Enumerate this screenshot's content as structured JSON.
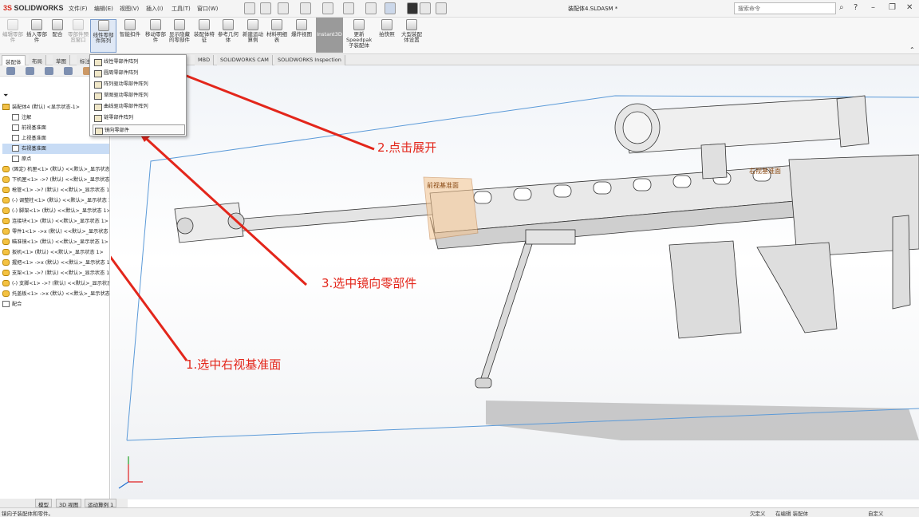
{
  "app": {
    "logo_prefix": "3S",
    "logo_text": "SOLIDWORKS",
    "doc_title": "装配体4.SLDASM *"
  },
  "menu": [
    "文件(F)",
    "编辑(E)",
    "视图(V)",
    "插入(I)",
    "工具(T)",
    "窗口(W)"
  ],
  "search": {
    "placeholder": "搜索命令"
  },
  "ribbon": [
    {
      "label": "编辑零部件",
      "disabled": true
    },
    {
      "label": "插入零部件"
    },
    {
      "label": "配合"
    },
    {
      "label": "零部件预览窗口",
      "disabled": true
    },
    {
      "label": "线性零部件阵列"
    },
    {
      "label": "智能扣件"
    },
    {
      "label": "移动零部件"
    },
    {
      "label": "显示隐藏的零部件"
    },
    {
      "label": "装配体特征"
    },
    {
      "label": "参考几何体"
    },
    {
      "label": "新建运动算例"
    },
    {
      "label": "材料明细表"
    },
    {
      "label": "爆炸视图"
    },
    {
      "label": "Instant3D"
    },
    {
      "label": "更新Speedpak子装配体"
    },
    {
      "label": "拍快照"
    },
    {
      "label": "大型装配体设置"
    }
  ],
  "tabs": [
    "装配体",
    "布局",
    "草图",
    "标注",
    "评估",
    "MBD",
    "SOLIDWORKS CAM",
    "SOLIDWORKS Inspection"
  ],
  "dropdown": [
    "线性零部件阵列",
    "圆周零部件阵列",
    "阵列驱动零部件阵列",
    "草图驱动零部件阵列",
    "曲线驱动零部件阵列",
    "链零部件阵列",
    "镜向零部件"
  ],
  "tree": [
    {
      "label": "装配体4 (默认) <显示状态-1>",
      "type": "asm",
      "indent": 0
    },
    {
      "label": "注解",
      "type": "plain",
      "indent": 1
    },
    {
      "label": "前视基准面",
      "type": "plain",
      "indent": 1
    },
    {
      "label": "上视基准面",
      "type": "plain",
      "indent": 1
    },
    {
      "label": "右视基准面",
      "type": "plain",
      "indent": 1,
      "selected": true
    },
    {
      "label": "原点",
      "type": "plain",
      "indent": 1
    },
    {
      "label": "(固定) 机匣<1> (默认) <<默认>_显示状态 1>",
      "type": "part",
      "indent": 0
    },
    {
      "label": "下机匣<1> ->? (默认) <<默认>_显示状态 1>",
      "type": "part",
      "indent": 0
    },
    {
      "label": "枪管<1> ->? (默认) <<默认>_显示状态 1>",
      "type": "part",
      "indent": 0
    },
    {
      "label": "(-) 调整柱<1> (默认) <<默认>_显示状态 1>",
      "type": "part",
      "indent": 0
    },
    {
      "label": "(-) 脚架<1> (默认) <<默认>_显示状态 1>",
      "type": "part",
      "indent": 0
    },
    {
      "label": "连接块<1> (默认) <<默认>_显示状态 1>",
      "type": "part",
      "indent": 0
    },
    {
      "label": "零件1<1> ->x (默认) <<默认>_显示状态 1>",
      "type": "part",
      "indent": 0
    },
    {
      "label": "瞄准镜<1> (默认) <<默认>_显示状态 1>",
      "type": "part",
      "indent": 0
    },
    {
      "label": "扳机<1> (默认) <<默认>_显示状态 1>",
      "type": "part",
      "indent": 0
    },
    {
      "label": "握把<1> ->x (默认) <<默认>_显示状态 1>",
      "type": "part",
      "indent": 0
    },
    {
      "label": "支架<1> ->? (默认) <<默认>_显示状态 1>",
      "type": "part",
      "indent": 0
    },
    {
      "label": "(-) 支脚<1> ->? (默认) <<默认>_显示状态 1>",
      "type": "part",
      "indent": 0
    },
    {
      "label": "托盖板<1> ->x (默认) <<默认>_显示状态 1>",
      "type": "part",
      "indent": 0
    },
    {
      "label": "配合",
      "type": "plain",
      "indent": 0
    }
  ],
  "viewport_labels": {
    "front_plane": "前视基准面",
    "right_plane": "右视基准面"
  },
  "annotations": {
    "step1": "1.选中右视基准面",
    "step2": "2.点击展开",
    "step3": "3.选中镜向零部件"
  },
  "bottom_tabs": [
    "模型",
    "3D 视图",
    "运动算例 1"
  ],
  "status": {
    "left": "镜向子装配体和零件。",
    "custom": "欠定义",
    "editing": "在编辑 装配体",
    "units": "自定义"
  },
  "colors": {
    "annotation": "#e3261b",
    "arrow": "#e3261b"
  }
}
